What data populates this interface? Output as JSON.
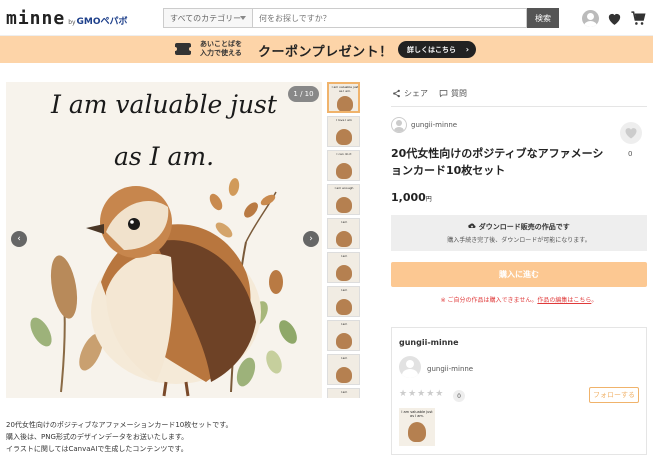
{
  "header": {
    "logo": "minne",
    "logo_by": "by",
    "logo_gmo": "GMO",
    "logo_pepabo": "ペパボ",
    "category_select": "すべてのカテゴリー",
    "search_placeholder": "何をお探しですか？",
    "search_button": "検索",
    "icons": [
      "user-icon",
      "heart-icon",
      "cart-icon"
    ]
  },
  "banner": {
    "small_line1": "あいことばを",
    "small_line2": "入力で使える",
    "main": "クーポンプレゼント！",
    "button": "詳しくはこちら",
    "bg_color": "#fdd4a8"
  },
  "gallery": {
    "image_text_line1": "I am valuable just",
    "image_text_line2": "as I am.",
    "counter": "1 / 10",
    "prev_icon": "chevron-left-icon",
    "next_icon": "chevron-right-icon",
    "thumbnails": [
      "I am valuable just as I am.",
      "I love I am",
      "I can do it",
      "I am enough",
      "I am",
      "I am",
      "I am",
      "I am",
      "I am",
      "I am"
    ]
  },
  "description": {
    "lines": [
      "20代女性向けのポジティブなアファメーションカード10枚セットです。",
      "購入後は、PNG形式のデザインデータをお送いたします。",
      "イラストに関してはCanvaAIで生成したコンテンツです。"
    ]
  },
  "product": {
    "share": "シェア",
    "question": "質問",
    "seller": "gungii-minne",
    "favorite_count": "0",
    "title": "20代女性向けのポジティブなアファメーションカード10枚セット",
    "price": "1,000",
    "price_unit": "円",
    "download_title": "ダウンロード販売の作品です",
    "download_sub": "購入手続き完了後、ダウンロードが可能になります。",
    "buy_button": "購入に進む",
    "warning_text": "※ ご自分の作品は購入できません。",
    "warning_link": "作品の編集はこちら",
    "warning_end": "。",
    "accent_color": "#f0b36b",
    "buy_color": "#fcc892"
  },
  "seller_card": {
    "title": "gungii-minne",
    "name": "gungii-minne",
    "stars": "★★★★★",
    "rating_count": "0",
    "follow_button": "フォローする",
    "thumb_text": "I am valuable just as I am."
  }
}
